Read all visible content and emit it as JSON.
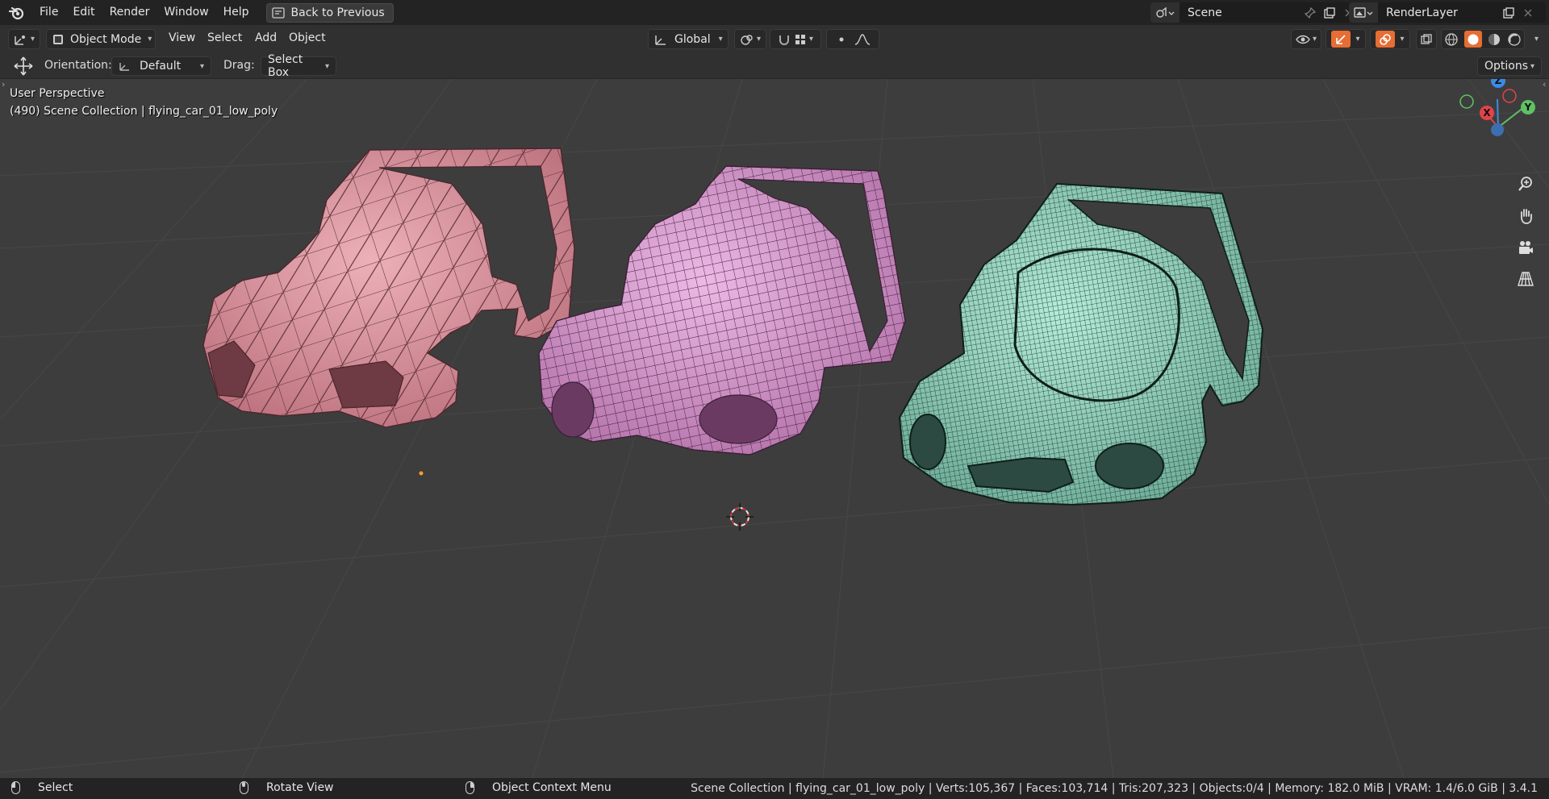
{
  "topbar": {
    "menus": [
      "File",
      "Edit",
      "Render",
      "Window",
      "Help"
    ],
    "back_button": "Back to Previous",
    "scene_name": "Scene",
    "render_layer": "RenderLayer"
  },
  "header": {
    "mode": "Object Mode",
    "menus": [
      "View",
      "Select",
      "Add",
      "Object"
    ],
    "orientation_global": "Global"
  },
  "toolrow": {
    "orientation_label": "Orientation:",
    "orientation_value": "Default",
    "drag_label": "Drag:",
    "drag_value": "Select Box",
    "options": "Options"
  },
  "viewport": {
    "perspective": "User Perspective",
    "collection": "(490) Scene Collection | flying_car_01_low_poly",
    "gizmo": {
      "x": "X",
      "y": "Y",
      "z": "Z"
    }
  },
  "statusbar": {
    "left_action": "Select",
    "middle_action": "Rotate View",
    "right_action": "Object Context Menu",
    "stats": "Scene Collection | flying_car_01_low_poly | Verts:105,367 | Faces:103,714 | Tris:207,323 | Objects:0/4 | Memory: 182.0 MiB | VRAM: 1.4/6.0 GiB | 3.4.1"
  },
  "colors": {
    "car_low": "#e2939f",
    "car_mid": "#dd98d4",
    "car_high": "#8fd9c0",
    "axis_x": "#e2434b",
    "axis_y": "#5fc164",
    "axis_z": "#3b8be5"
  }
}
